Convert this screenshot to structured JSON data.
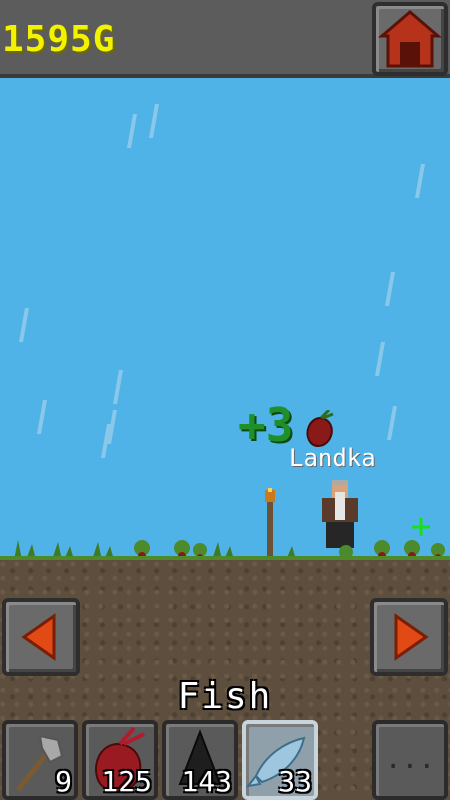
{
  "hud": {
    "gold": "1595G",
    "home_icon": "house-icon"
  },
  "world": {
    "gain_text": "+3",
    "gain_icon": "beet-icon",
    "npc_name": "Landka",
    "sparkle_icon": "sparkle-icon"
  },
  "controls": {
    "left_icon": "arrow-left-icon",
    "right_icon": "arrow-right-icon",
    "action_label": "Fish"
  },
  "inventory": {
    "slots": [
      {
        "item": "axe-icon",
        "count": "9"
      },
      {
        "item": "beet-icon",
        "count": "125"
      },
      {
        "item": "stone-icon",
        "count": "143"
      },
      {
        "item": "fish-icon",
        "count": "33",
        "selected": true
      }
    ],
    "menu_label": "..."
  },
  "colors": {
    "sky": "#4fb3e8",
    "gold_text": "#f3f300",
    "gain_text": "#1f8f2a",
    "button_arrow": "#e14a15"
  }
}
